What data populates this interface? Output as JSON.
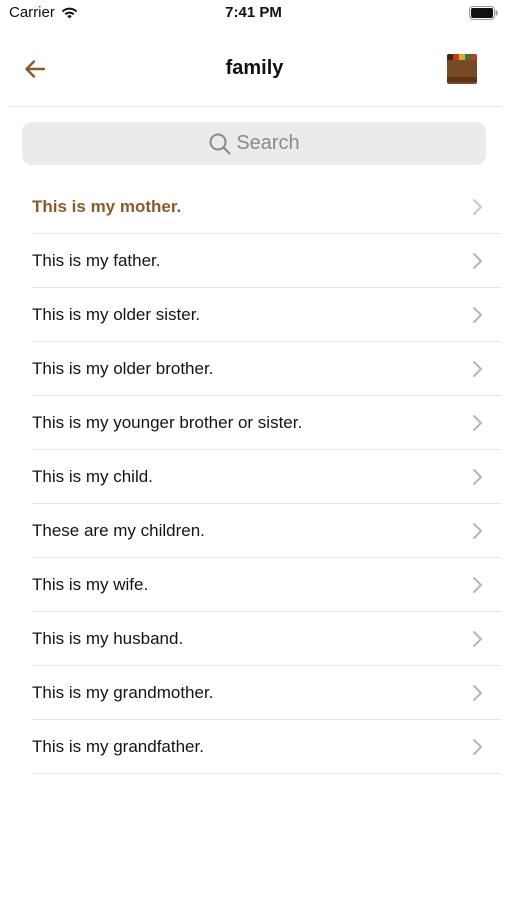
{
  "status_bar": {
    "carrier": "Carrier",
    "time": "7:41 PM"
  },
  "nav": {
    "title": "family",
    "back_icon": "arrow-left-icon",
    "thumbnail_icon": "book-cover-thumbnail"
  },
  "search": {
    "placeholder": "Search",
    "icon": "search-icon"
  },
  "colors": {
    "accent": "#8b5a2b",
    "chevron": "#b5b5b5",
    "separator": "#e6e6e6",
    "search_bg": "#ebebeb"
  },
  "phrases": [
    {
      "label": "This is my mother.",
      "active": true
    },
    {
      "label": "This is my father.",
      "active": false
    },
    {
      "label": "This is my older sister.",
      "active": false
    },
    {
      "label": "This is my older brother.",
      "active": false
    },
    {
      "label": "This is my younger brother or sister.",
      "active": false
    },
    {
      "label": "This is my child.",
      "active": false
    },
    {
      "label": "These are my children.",
      "active": false
    },
    {
      "label": "This is my wife.",
      "active": false
    },
    {
      "label": "This is my husband.",
      "active": false
    },
    {
      "label": "This is my grandmother.",
      "active": false
    },
    {
      "label": "This is my grandfather.",
      "active": false
    }
  ]
}
